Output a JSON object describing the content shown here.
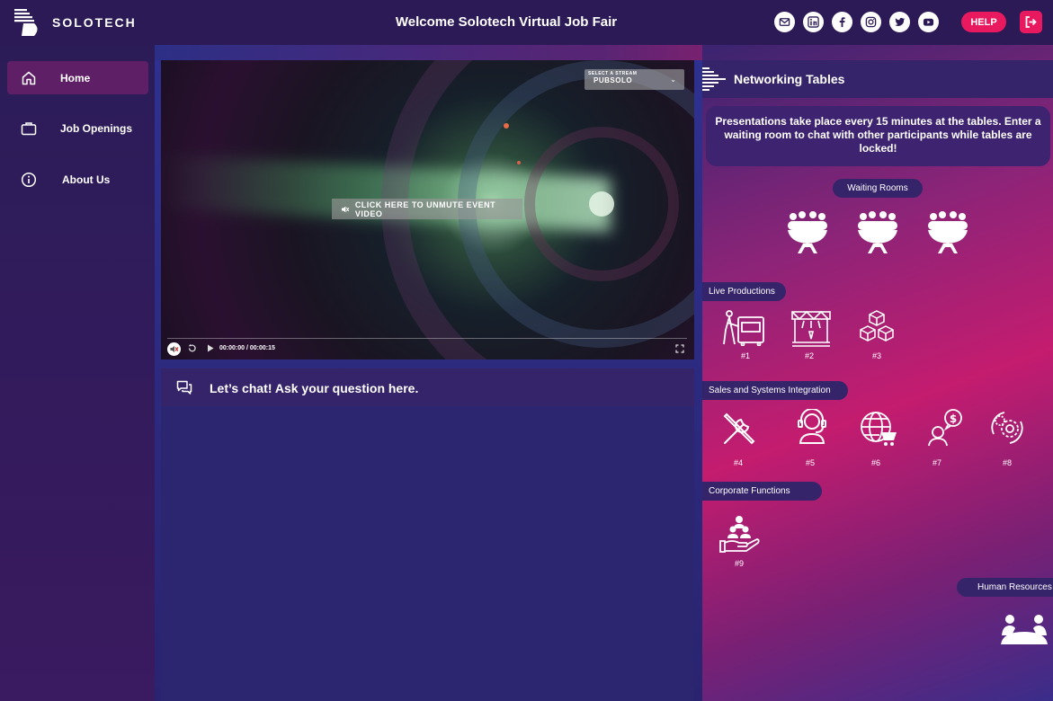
{
  "app": {
    "brand": "SOLOTECH",
    "title": "Welcome Solotech Virtual Job Fair"
  },
  "header": {
    "social_icons": [
      "mail-icon",
      "linkedin-icon",
      "facebook-icon",
      "instagram-icon",
      "twitter-icon",
      "youtube-icon"
    ],
    "help_label": "HELP",
    "accent": "#e8195e"
  },
  "sidebar": {
    "items": [
      {
        "label": "Home",
        "icon": "home-icon",
        "active": true
      },
      {
        "label": "Job Openings",
        "icon": "briefcase-icon",
        "active": false
      },
      {
        "label": "About Us",
        "icon": "info-icon",
        "active": false
      }
    ]
  },
  "video": {
    "stream_caption": "SELECT A STREAM",
    "stream_value": "PUBSOLO",
    "unmute_label": "CLICK HERE TO UNMUTE EVENT VIDEO",
    "time": "00:00:00 / 00:00:15"
  },
  "chat": {
    "title": "Let’s chat! Ask your question here."
  },
  "networking": {
    "title": "Networking Tables",
    "notice": "Presentations take place every 15 minutes at the tables. Enter a waiting room to chat with other participants while tables are locked!",
    "waiting_rooms": "Waiting Rooms",
    "sections": [
      {
        "label": "Live Productions",
        "tables": [
          "#1",
          "#2",
          "#3"
        ]
      },
      {
        "label": "Sales and Systems Integration",
        "tables": [
          "#4",
          "#5",
          "#6",
          "#7",
          "#8"
        ]
      },
      {
        "label": "Corporate Functions",
        "tables": [
          "#9"
        ]
      },
      {
        "label": "Human Resources",
        "tables": []
      }
    ]
  }
}
